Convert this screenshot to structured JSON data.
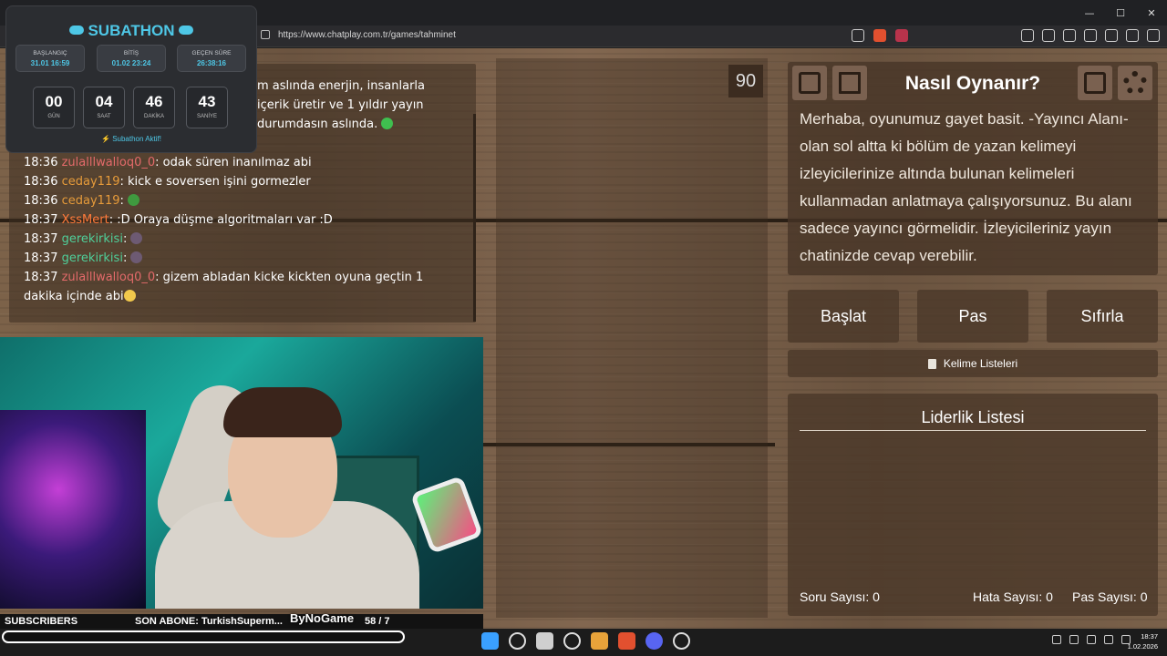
{
  "browser": {
    "url": "https://www.chatplay.com.tr/games/tahminet",
    "window_controls": [
      "—",
      "☐",
      "✕"
    ]
  },
  "subathon": {
    "title": "SUBATHON",
    "boxes": [
      {
        "label": "BAŞLANGIÇ",
        "value": "31.01 16:59"
      },
      {
        "label": "BİTİŞ",
        "value": "01.02 23:24"
      },
      {
        "label": "GEÇEN SÜRE",
        "value": "26:38:16"
      }
    ],
    "countdown": [
      {
        "number": "00",
        "unit": "GÜN"
      },
      {
        "number": "04",
        "unit": "SAAT"
      },
      {
        "number": "46",
        "unit": "DAKİKA"
      },
      {
        "number": "43",
        "unit": "SANİYE"
      }
    ],
    "status": "Subathon Aktif!"
  },
  "chat": {
    "top_lines": [
      "m aslında enerjin, insanlarla",
      "içerik üretir ve 1 yıldır yayın",
      "durumdasın aslında."
    ],
    "messages": [
      {
        "time": "18:36",
        "user": "zulalllwalloq0_0",
        "text": ": odak süren inanılmaz abi"
      },
      {
        "time": "18:36",
        "user": "ceday119",
        "text": ": kick e soversen işini gormezler"
      },
      {
        "time": "18:36",
        "user": "ceday119",
        "text": ":"
      },
      {
        "time": "18:37",
        "user": "XssMert",
        "text": ": :D Oraya düşme algoritmaları var :D"
      },
      {
        "time": "18:37",
        "user": "gerekirkisi",
        "text": ":"
      },
      {
        "time": "18:37",
        "user": "gerekirkisi",
        "text": ":"
      },
      {
        "time": "18:37",
        "user": "zulalllwalloq0_0",
        "text": ": gizem abladan kicke kickten oyuna geçtin 1 dakika içinde abi"
      }
    ]
  },
  "game": {
    "counter": "90",
    "how_to_title": "Nasıl Oynanır?",
    "how_to_text": "Merhaba, oyunumuz gayet basit. -Yayıncı Alanı- olan sol altta ki bölüm de yazan kelimeyi izleyicilerinize altında bulunan kelimeleri kullanmadan anlatmaya çalışıyorsunuz. Bu alanı sadece yayıncı görmelidir. İzleyicileriniz yayın chatinizde cevap verebilir.",
    "buttons": {
      "start": "Başlat",
      "pass": "Pas",
      "reset": "Sıfırla"
    },
    "word_lists": "Kelime Listeleri",
    "leaderboard_title": "Liderlik Listesi",
    "stats": {
      "questions": "Soru Sayısı: 0",
      "errors": "Hata Sayısı: 0",
      "passes": "Pas Sayısı: 0"
    }
  },
  "overlay": {
    "subscribers_label": "SUBSCRIBERS",
    "last_sub": "SON ABONE: TurkishSuperm...",
    "count": "58 / 7",
    "brand": "ByNoGame"
  },
  "taskbar": {
    "time": "18:37",
    "date": "1.02.2026"
  },
  "colors": {
    "subathon_accent": "#4ec7e6",
    "wood": "#7c6249"
  }
}
